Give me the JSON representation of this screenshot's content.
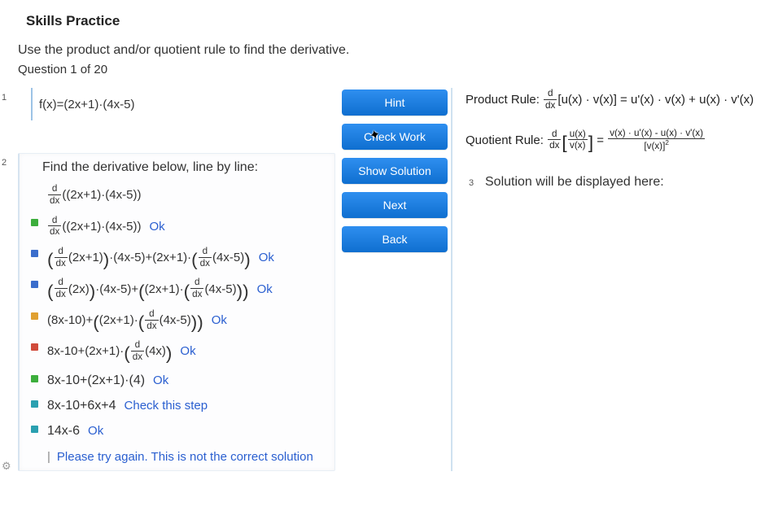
{
  "title": "Skills Practice",
  "instructions": "Use the product and/or quotient rule to find the derivative.",
  "questionLabel": "Question 1 of 20",
  "panelNums": {
    "left1": "1",
    "left2": "2",
    "right": "3"
  },
  "problem": "f(x)=(2x+1)·(4x-5)",
  "workTitle": "Find the derivative below, line by line:",
  "steps": [
    {
      "expr_html": "<span class='frac'><span class='num'>d</span><span class='den'>dx</span></span>((2x+1)·(4x-5))",
      "status": "",
      "tag": ""
    },
    {
      "expr_html": "<span class='frac'><span class='num'>d</span><span class='den'>dx</span></span>((2x+1)·(4x-5))",
      "status": "Ok",
      "tag": "green"
    },
    {
      "expr_html": "<span class='lp'>(</span><span class='frac'><span class='num'>d</span><span class='den'>dx</span></span>(2x+1)<span class='rp'>)</span>·(4x-5)+(2x+1)·<span class='lp'>(</span><span class='frac'><span class='num'>d</span><span class='den'>dx</span></span>(4x-5)<span class='rp'>)</span>",
      "status": "Ok",
      "tag": "blue"
    },
    {
      "expr_html": "<span class='lp'>(</span><span class='frac'><span class='num'>d</span><span class='den'>dx</span></span>(2x)<span class='rp'>)</span>·(4x-5)+<span class='lp'>(</span>(2x+1)·<span class='lp'>(</span><span class='frac'><span class='num'>d</span><span class='den'>dx</span></span>(4x-5)<span class='rp'>)</span><span class='rp'>)</span>",
      "status": "Ok",
      "tag": "blue"
    },
    {
      "expr_html": "(8x-10)+<span class='lp'>(</span>(2x+1)·<span class='lp'>(</span><span class='frac'><span class='num'>d</span><span class='den'>dx</span></span>(4x-5)<span class='rp'>)</span><span class='rp'>)</span>",
      "status": "Ok",
      "tag": "orange"
    },
    {
      "expr_html": "8x-10+(2x+1)·<span class='lp'>(</span><span class='frac'><span class='num'>d</span><span class='den'>dx</span></span>(4x)<span class='rp'>)</span>",
      "status": "Ok",
      "tag": "red"
    },
    {
      "expr_html": "8x-10+(2x+1)·(4)",
      "status": "Ok",
      "tag": "green"
    },
    {
      "expr_html": "8x-10+6x+4",
      "status": "Check this step",
      "tag": "teal"
    },
    {
      "expr_html": "14x-6",
      "status": "Ok",
      "tag": "teal"
    }
  ],
  "finalMessage": "Please try again. This is not the correct solution",
  "buttons": {
    "hint": "Hint",
    "check": "Check Work",
    "show": "Show Solution",
    "next": "Next",
    "back": "Back"
  },
  "productRuleLabel": "Product Rule: ",
  "productRule_html": "<span class='frac'><span class='num'>d</span><span class='den'>dx</span></span>[u(x) · v(x)] = u'(x) · v(x) + u(x) · v'(x)",
  "quotientRuleLabel": "Quotient Rule: ",
  "quotientRule_html": "<span class='frac'><span class='num'>d</span><span class='den'>dx</span></span><span class='lb'>[</span><span class='frac'><span class='num'>u(x)</span><span class='den'>v(x)</span></span><span class='rb'>]</span> = <span class='frac'><span class='num'>v(x) · u'(x) - u(x) · v'(x)</span><span class='den'>[v(x)]<span class='sq'>2</span></span></span>",
  "solutionPlaceholder": "Solution will be displayed here:"
}
